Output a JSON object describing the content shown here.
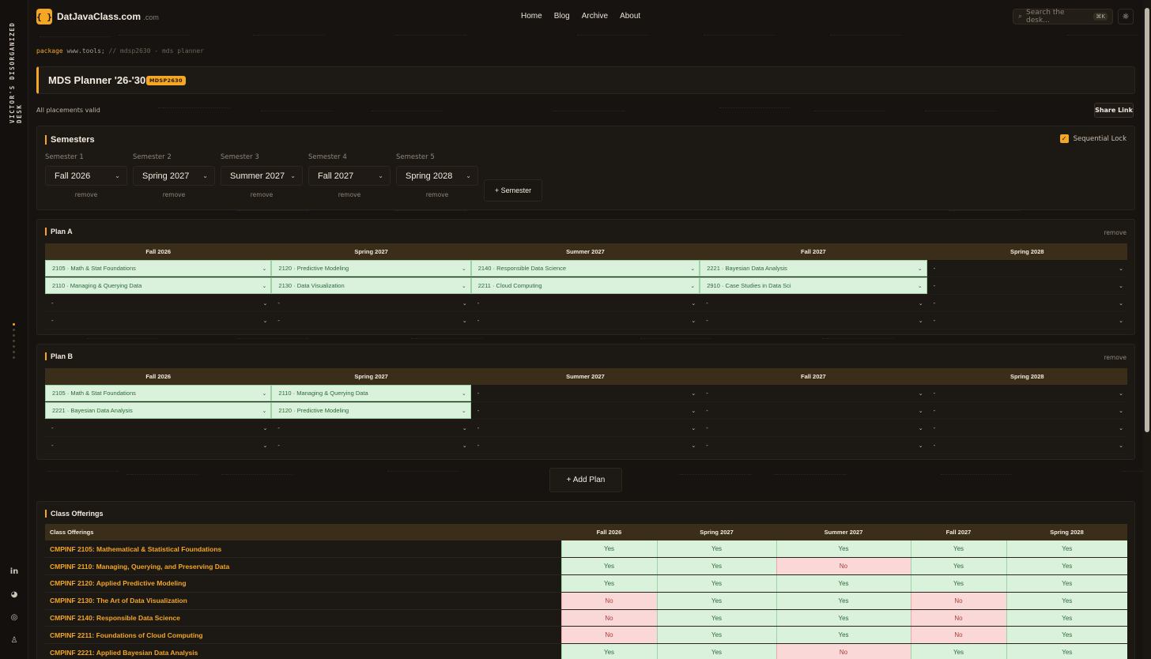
{
  "rail": {
    "title": "VICTOR'S DISORGANIZED DESK",
    "icons": [
      "linkedin-icon",
      "reddit-icon",
      "github-icon",
      "person-icon"
    ],
    "icon_glyphs": [
      "in",
      "◕",
      "◎",
      "♙"
    ]
  },
  "header": {
    "logo_glyph": "{ }",
    "brand": "DatJavaClass.com",
    "brand_suffix": ".com",
    "nav": [
      "Home",
      "Blog",
      "Archive",
      "About"
    ],
    "search_placeholder": "Search the desk...",
    "search_shortcut": "⌘K",
    "theme_glyph": "☼"
  },
  "code_line": {
    "keyword": "package",
    "text": "www.tools;",
    "comment": "// mdsp2630 - mds planner"
  },
  "title": {
    "text": "MDS Planner '26-'30",
    "badge": "MDSP2630"
  },
  "status": "All placements valid",
  "share_label": "Share Link",
  "semesters": {
    "heading": "Semesters",
    "lock_label": "Sequential Lock",
    "lock_checked": true,
    "remove_label": "remove",
    "add_label": "+ Semester",
    "items": [
      {
        "label": "Semester 1",
        "value": "Fall 2026"
      },
      {
        "label": "Semester 2",
        "value": "Spring 2027"
      },
      {
        "label": "Semester 3",
        "value": "Summer 2027"
      },
      {
        "label": "Semester 4",
        "value": "Fall 2027"
      },
      {
        "label": "Semester 5",
        "value": "Spring 2028"
      }
    ]
  },
  "plans": [
    {
      "name": "Plan A",
      "remove_label": "remove",
      "columns": [
        "Fall 2026",
        "Spring 2027",
        "Summer 2027",
        "Fall 2027",
        "Spring 2028"
      ],
      "rows": [
        [
          "2105 · Math & Stat Foundations",
          "2120 · Predictive Modeling",
          "2140 · Responsible Data Science",
          "2221 · Bayesian Data Analysis",
          "-"
        ],
        [
          "2110 · Managing & Querying Data",
          "2130 · Data Visualization",
          "2211 · Cloud Computing",
          "2910 · Case Studies in Data Sci",
          "-"
        ],
        [
          "-",
          "-",
          "-",
          "-",
          "-"
        ],
        [
          "-",
          "-",
          "-",
          "-",
          "-"
        ]
      ]
    },
    {
      "name": "Plan B",
      "remove_label": "remove",
      "columns": [
        "Fall 2026",
        "Spring 2027",
        "Summer 2027",
        "Fall 2027",
        "Spring 2028"
      ],
      "rows": [
        [
          "2105 · Math & Stat Foundations",
          "2110 · Managing & Querying Data",
          "-",
          "-",
          "-"
        ],
        [
          "2221 · Bayesian Data Analysis",
          "2120 · Predictive Modeling",
          "-",
          "-",
          "-"
        ],
        [
          "-",
          "-",
          "-",
          "-",
          "-"
        ],
        [
          "-",
          "-",
          "-",
          "-",
          "-"
        ]
      ]
    }
  ],
  "add_plan_label": "+ Add Plan",
  "offerings": {
    "heading": "Class Offerings",
    "columns": [
      "Class Offerings",
      "Fall 2026",
      "Spring 2027",
      "Summer 2027",
      "Fall 2027",
      "Spring 2028"
    ],
    "rows": [
      {
        "course": "CMPINF 2105: Mathematical & Statistical Foundations",
        "values": [
          "Yes",
          "Yes",
          "Yes",
          "Yes",
          "Yes"
        ]
      },
      {
        "course": "CMPINF 2110: Managing, Querying, and Preserving Data",
        "values": [
          "Yes",
          "Yes",
          "No",
          "Yes",
          "Yes"
        ]
      },
      {
        "course": "CMPINF 2120: Applied Predictive Modeling",
        "values": [
          "Yes",
          "Yes",
          "Yes",
          "Yes",
          "Yes"
        ]
      },
      {
        "course": "CMPINF 2130: The Art of Data Visualization",
        "values": [
          "No",
          "Yes",
          "Yes",
          "No",
          "Yes"
        ]
      },
      {
        "course": "CMPINF 2140: Responsible Data Science",
        "values": [
          "No",
          "Yes",
          "Yes",
          "No",
          "Yes"
        ]
      },
      {
        "course": "CMPINF 2211: Foundations of Cloud Computing",
        "values": [
          "No",
          "Yes",
          "Yes",
          "No",
          "Yes"
        ]
      },
      {
        "course": "CMPINF 2221: Applied Bayesian Data Analysis",
        "values": [
          "Yes",
          "Yes",
          "No",
          "Yes",
          "Yes"
        ]
      }
    ]
  },
  "colors": {
    "accent": "#f5a623",
    "background": "#161310",
    "panel": "#1c1814",
    "yes_bg": "#daf1dc",
    "no_bg": "#fbd8d8"
  }
}
